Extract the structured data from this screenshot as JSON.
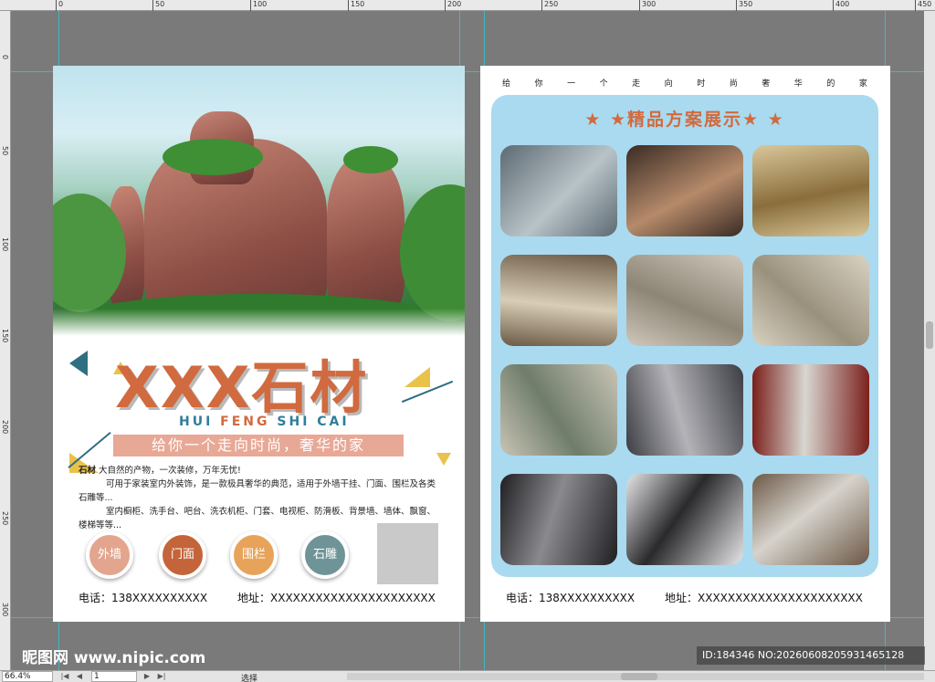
{
  "ruler": {
    "top_ticks": [
      "0",
      "50",
      "100",
      "150",
      "200",
      "250",
      "300",
      "350",
      "400",
      "450"
    ],
    "left_ticks": [
      "0",
      "50",
      "100",
      "150",
      "200",
      "250",
      "300"
    ]
  },
  "left_page": {
    "title": "XXX石材",
    "subtitle_a": "HUI ",
    "subtitle_b": "FENG ",
    "subtitle_c": "SHI CAI",
    "slogan": "给你一个走向时尚，奢华的家",
    "intro_lead": "石材",
    "intro_1": " 大自然的产物，一次装修，万年无忧!",
    "intro_2": "可用于家装室内外装饰，是一款极具奢华的典范，适用于外墙干挂、门面、围栏及各类石雕等...",
    "intro_3": "室内橱柜、洗手台、吧台、洗衣机柜、门套、电视柜、防滑板、背景墙、墙体、飘窗、楼梯等等...",
    "circles": [
      {
        "label": "外墙",
        "color": "#e3a58e"
      },
      {
        "label": "门面",
        "color": "#c4643a"
      },
      {
        "label": "围栏",
        "color": "#e8a35a"
      },
      {
        "label": "石雕",
        "color": "#6f9497"
      }
    ],
    "phone": "电话：138XXXXXXXXXX",
    "address": "地址：XXXXXXXXXXXXXXXXXXXXXX"
  },
  "right_page": {
    "tagline": [
      "给",
      "你",
      "一",
      "个",
      "走",
      "向",
      "时",
      "尚",
      "奢",
      "华",
      "的",
      "家"
    ],
    "panel_title": "★  ★精品方案展示★  ★",
    "tiles": [
      {
        "name": "building-facade",
        "color_a": "#5d6a72",
        "color_b": "#b8c3c8"
      },
      {
        "name": "staircase",
        "color_a": "#3a2b24",
        "color_b": "#b58a6a"
      },
      {
        "name": "arch-doorway",
        "color_a": "#d9c79a",
        "color_b": "#8a6e3c"
      },
      {
        "name": "marble-wall-1",
        "color_a": "#6b5a45",
        "color_b": "#d8cdb6"
      },
      {
        "name": "marble-wall-2",
        "color_a": "#cfc8bb",
        "color_b": "#8d8677"
      },
      {
        "name": "marble-wall-3",
        "color_a": "#d9d2c2",
        "color_b": "#9a917d"
      },
      {
        "name": "landscape-wall",
        "color_a": "#c9c4b6",
        "color_b": "#6f7d6a"
      },
      {
        "name": "kitchen-counter-gray",
        "color_a": "#3c3d42",
        "color_b": "#b3b3b8"
      },
      {
        "name": "kitchen-red-cabinet",
        "color_a": "#7a1e1a",
        "color_b": "#d8d6d0"
      },
      {
        "name": "bathroom-sink-dark",
        "color_a": "#1f1f22",
        "color_b": "#8a8a8e"
      },
      {
        "name": "vessel-sink",
        "color_a": "#e6e6e8",
        "color_b": "#2a2a2d"
      },
      {
        "name": "bathroom-vanity",
        "color_a": "#6c5846",
        "color_b": "#d6d3cc"
      }
    ],
    "phone": "电话：138XXXXXXXXXX",
    "address": "地址：XXXXXXXXXXXXXXXXXXXXXX"
  },
  "footer": {
    "watermark": "昵图网 www.nipic.com",
    "id_text": "ID:184346 NO:20260608205931465128"
  },
  "status": {
    "zoom": "66.4%",
    "page": "1",
    "mode": "选择"
  }
}
